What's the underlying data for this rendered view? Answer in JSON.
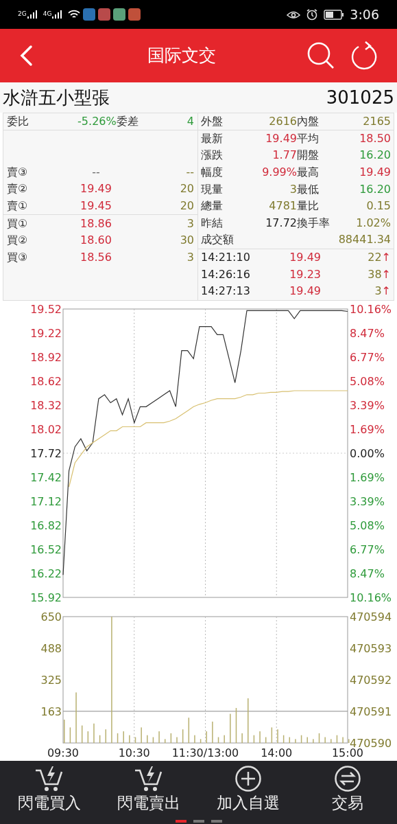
{
  "status_bar": {
    "network_1": "2G",
    "network_2": "4G",
    "time": "3:06"
  },
  "header": {
    "title": "国际文交"
  },
  "instrument": {
    "name": "水滸五小型張",
    "code": "301025"
  },
  "order_book": {
    "ratio_label": "委比",
    "ratio": "-5.26%",
    "diff_label": "委差",
    "diff": "4",
    "asks": [
      {
        "label": "賣③",
        "price": "--",
        "volume": "--",
        "color": "#666666"
      },
      {
        "label": "賣②",
        "price": "19.49",
        "volume": "20",
        "color": "#d02a3a"
      },
      {
        "label": "賣①",
        "price": "19.45",
        "volume": "20",
        "color": "#d02a3a"
      }
    ],
    "bids": [
      {
        "label": "買①",
        "price": "18.86",
        "volume": "3",
        "color": "#d02a3a"
      },
      {
        "label": "買②",
        "price": "18.60",
        "volume": "30",
        "color": "#d02a3a"
      },
      {
        "label": "買③",
        "price": "18.56",
        "volume": "3",
        "color": "#d02a3a"
      }
    ]
  },
  "quotes": [
    [
      {
        "label": "外盤",
        "value": "2616",
        "color": "#7f7a2e"
      },
      {
        "label": "內盤",
        "value": "2165",
        "color": "#7f7a2e"
      }
    ],
    [
      {
        "label": "最新",
        "value": "19.49",
        "color": "#d02a3a"
      },
      {
        "label": "平均",
        "value": "18.50",
        "color": "#d02a3a"
      }
    ],
    [
      {
        "label": "漲跌",
        "value": "1.77",
        "color": "#d02a3a"
      },
      {
        "label": "開盤",
        "value": "16.20",
        "color": "#2e9a3a"
      }
    ],
    [
      {
        "label": "幅度",
        "value": "9.99%",
        "color": "#d02a3a"
      },
      {
        "label": "最高",
        "value": "19.49",
        "color": "#d02a3a"
      }
    ],
    [
      {
        "label": "現量",
        "value": "3",
        "color": "#7f7a2e"
      },
      {
        "label": "最低",
        "value": "16.20",
        "color": "#2e9a3a"
      }
    ],
    [
      {
        "label": "總量",
        "value": "4781",
        "color": "#7f7a2e"
      },
      {
        "label": "量比",
        "value": "0.15",
        "color": "#7f7a2e"
      }
    ],
    [
      {
        "label": "昨結",
        "value": "17.72",
        "color": "#222222"
      },
      {
        "label": "換手率",
        "value": "1.02%",
        "color": "#7f7a2e"
      }
    ],
    [
      {
        "label": "成交額",
        "value": "88441.34",
        "color": "#7f7a2e"
      }
    ]
  ],
  "trades": [
    {
      "time": "14:21:10",
      "price": "19.49",
      "volume": "22",
      "arrow": "↑"
    },
    {
      "time": "14:26:16",
      "price": "19.23",
      "volume": "38",
      "arrow": "↑"
    },
    {
      "time": "14:27:13",
      "price": "19.49",
      "volume": "3",
      "arrow": "↑"
    }
  ],
  "price_chart": {
    "right_axis_labels": [
      "10.16%",
      "8.47%",
      "6.77%",
      "5.08%",
      "3.39%",
      "1.69%",
      "0.00%",
      "1.69%",
      "3.39%",
      "5.08%",
      "6.77%",
      "8.47%",
      "10.16%"
    ],
    "chart_data": {
      "type": "line",
      "ylim": [
        15.92,
        19.52
      ],
      "grid": true,
      "yticks": [
        {
          "value": 19.52,
          "label": "19.52"
        },
        {
          "value": 19.22,
          "label": "19.22"
        },
        {
          "value": 18.92,
          "label": "18.92"
        },
        {
          "value": 18.62,
          "label": "18.62"
        },
        {
          "value": 18.32,
          "label": "18.32"
        },
        {
          "value": 18.02,
          "label": "18.02"
        },
        {
          "value": 17.72,
          "label": "17.72"
        },
        {
          "value": 17.42,
          "label": "17.42"
        },
        {
          "value": 17.12,
          "label": "17.12"
        },
        {
          "value": 16.82,
          "label": "16.82"
        },
        {
          "value": 16.52,
          "label": "16.52"
        },
        {
          "value": 16.22,
          "label": "16.22"
        },
        {
          "value": 15.92,
          "label": "15.92"
        }
      ],
      "series": [
        {
          "color": "#333333",
          "values": [
            16.2,
            17.5,
            17.8,
            17.9,
            17.75,
            17.85,
            18.4,
            18.45,
            18.35,
            18.4,
            18.2,
            18.4,
            18.1,
            18.3,
            18.3,
            18.35,
            18.4,
            18.45,
            18.5,
            18.3,
            19.0,
            19.0,
            18.9,
            19.3,
            19.3,
            19.3,
            19.2,
            19.2,
            18.9,
            18.6,
            19.0,
            19.5,
            19.5,
            19.5,
            19.5,
            19.5,
            19.5,
            19.5,
            19.5,
            19.4,
            19.5,
            19.5,
            19.5,
            19.5,
            19.5,
            19.5,
            19.5,
            19.5,
            19.49
          ]
        },
        {
          "color": "#d8c070",
          "values": [
            null,
            17.3,
            17.6,
            17.7,
            17.8,
            17.85,
            17.9,
            17.95,
            18.0,
            18.0,
            18.05,
            18.05,
            18.05,
            18.05,
            18.1,
            18.1,
            18.1,
            18.1,
            18.12,
            18.15,
            18.2,
            18.25,
            18.3,
            18.33,
            18.35,
            18.38,
            18.4,
            18.4,
            18.4,
            18.4,
            18.42,
            18.45,
            18.45,
            18.47,
            18.47,
            18.48,
            18.48,
            18.49,
            18.49,
            18.5,
            18.5,
            18.5,
            18.5,
            18.5,
            18.5,
            18.5,
            18.5,
            18.5,
            18.5
          ]
        }
      ]
    }
  },
  "volume_chart": {
    "right_axis_labels": [
      "470594",
      "470593",
      "470592",
      "470591",
      "470590"
    ],
    "x_axis_labels": [
      "09:30",
      "10:30",
      "11:30/13:00",
      "14:00",
      "15:00"
    ],
    "chart_data": {
      "type": "bar",
      "ylim": [
        0,
        650
      ],
      "grid": true,
      "yticks": [
        {
          "value": 650,
          "label": "650"
        },
        {
          "value": 488,
          "label": "488"
        },
        {
          "value": 325,
          "label": "325"
        },
        {
          "value": 163,
          "label": "163"
        }
      ],
      "series": [
        {
          "color": "#b8b070",
          "values": [
            120,
            80,
            260,
            90,
            60,
            100,
            40,
            70,
            650,
            50,
            60,
            40,
            30,
            80,
            40,
            30,
            60,
            20,
            50,
            30,
            70,
            130,
            40,
            20,
            60,
            110,
            30,
            40,
            150,
            180,
            50,
            230,
            40,
            60,
            30,
            80,
            70,
            40,
            30,
            20,
            40,
            30,
            20,
            50,
            30,
            20,
            40,
            30,
            20
          ]
        }
      ]
    }
  },
  "actions": [
    {
      "label": "閃電買入",
      "kind": "cart"
    },
    {
      "label": "閃電賣出",
      "kind": "cart"
    },
    {
      "label": "加入自選",
      "kind": "plus"
    },
    {
      "label": "交易",
      "kind": "swap"
    }
  ],
  "pages": [
    {
      "selected": true
    },
    {
      "selected": false
    },
    {
      "selected": false
    }
  ]
}
